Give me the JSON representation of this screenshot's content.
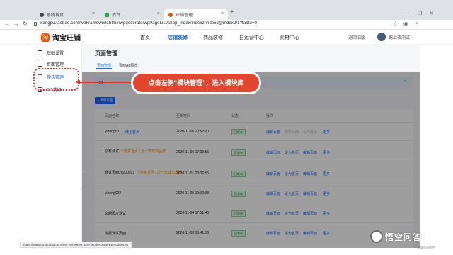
{
  "browser": {
    "tabs": [
      {
        "label": "系统首页",
        "icon": "globe-icon"
      },
      {
        "label": "后台",
        "icon": "app-icon"
      },
      {
        "label": "旺铺管理",
        "icon": "shop-icon"
      }
    ],
    "new_tab": "+",
    "url": "wangpu.taobao.com/wpFramework.htm#/wpdecorate/wpPageList/shop_index/index2/index2@index2/1?tabId=0",
    "status_url": "https://wangpu.taobao.com/wpFramework.htm#/wpdecorate/wpModuleList"
  },
  "header": {
    "logo": "淘宝旺铺",
    "nav": [
      "首页",
      "店铺装修",
      "商品装修",
      "自运营中心",
      "素材中心"
    ],
    "active_nav": "店铺装修",
    "return": "返回旧版",
    "user": "鹅上夜测试"
  },
  "sidebar": {
    "items": [
      {
        "label": "基础设置",
        "icon": "settings-icon"
      },
      {
        "label": "页面管理",
        "icon": "page-icon"
      },
      {
        "label": "模块管理",
        "icon": "module-icon"
      },
      {
        "label": "PC装修",
        "icon": "desktop-icon"
      }
    ],
    "active": "模块管理"
  },
  "main": {
    "title": "页面管理",
    "subtabs": [
      "页面管理",
      "页面AB预览"
    ],
    "new_button": "+ 新建页面",
    "columns": [
      "页面名称",
      "更新时间",
      "状态",
      "操作"
    ],
    "rows": [
      {
        "name": "yiheng001",
        "tag": "线上首页",
        "time": "2020-11-06 10:52:20",
        "status": "已发布",
        "actions": [
          "编辑页面",
          "预览页面",
          "设为首页",
          "更多"
        ]
      },
      {
        "name": "原有测试",
        "tag": "个性化首页 | 近一年成交品牌",
        "time": "2020-11-06 17:03:55",
        "status": "已发布",
        "actions": [
          "编辑页面",
          "设为首页",
          "编辑页面",
          "更多"
        ]
      },
      {
        "name": "默认页面20200923",
        "tag": "个性化首页 | 近一年成交品牌",
        "time": "2020-11-01 23:06:56",
        "status": "已发布",
        "actions": [
          "编辑页面",
          "设为首页",
          "编辑页面",
          "更多"
        ]
      },
      {
        "name": "yiheng002",
        "tag": "",
        "time": "2020-11-05 19:02:08",
        "status": "已发布",
        "actions": [
          "编辑页面",
          "设为首页",
          "编辑页面",
          "更多"
        ]
      },
      {
        "name": "文朗再次测试",
        "tag": "",
        "time": "2020-11-04 17:51:40",
        "status": "已发布",
        "actions": [
          "编辑页面",
          "设为首页",
          "编辑页面",
          "更多"
        ]
      },
      {
        "name": "消费测试页面",
        "tag": "",
        "time": "2020-11-03 15:41:00",
        "status": "已发布",
        "actions": [
          "编辑页面",
          "设为首页",
          "编辑页面",
          "更多"
        ]
      }
    ]
  },
  "callout": "点击左侧“模块管理”，进入模块库",
  "watermark": {
    "text": "悟空问答",
    "sub": "头条号@悟空"
  },
  "colors": {
    "accent": "#1a66ff",
    "callout": "#e3462f",
    "highlight": "#e0322b"
  }
}
